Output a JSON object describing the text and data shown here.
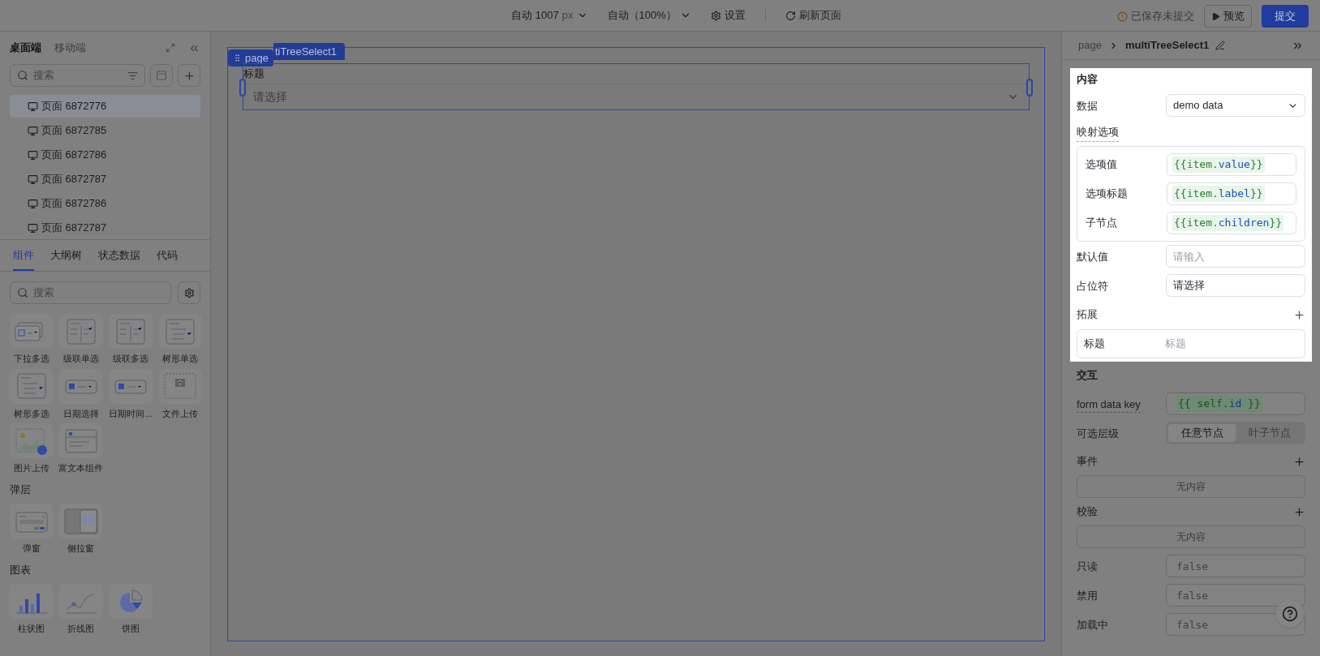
{
  "toolbar": {
    "width_select": "自动 1007",
    "width_unit": "px",
    "zoom_select": "自动（100%）",
    "settings": "设置",
    "refresh": "刷新页面",
    "save_status": "已保存未提交",
    "preview": "预览",
    "submit": "提交"
  },
  "sidebar": {
    "platform_tabs": [
      {
        "label": "桌面端",
        "selected": true
      },
      {
        "label": "移动端",
        "selected": false
      }
    ],
    "page_search_placeholder": "搜索",
    "pages": [
      {
        "label": "页面 6872776",
        "selected": true
      },
      {
        "label": "页面 6872785",
        "selected": false
      },
      {
        "label": "页面 6872786",
        "selected": false
      },
      {
        "label": "页面 6872787",
        "selected": false
      },
      {
        "label": "页面 6872786",
        "selected": false
      },
      {
        "label": "页面 6872787",
        "selected": false
      }
    ],
    "panel_tabs": [
      {
        "label": "组件",
        "selected": true
      },
      {
        "label": "大纲树",
        "selected": false
      },
      {
        "label": "状态数据",
        "selected": false
      },
      {
        "label": "代码",
        "selected": false
      }
    ],
    "component_search_placeholder": "搜索",
    "groups": [
      {
        "items": [
          {
            "label": "下拉多选",
            "kind": "dropdown"
          },
          {
            "label": "级联单选",
            "kind": "cascader"
          },
          {
            "label": "级联多选",
            "kind": "cascader"
          },
          {
            "label": "树形单选",
            "kind": "tree"
          },
          {
            "label": "树形多选",
            "kind": "tree"
          },
          {
            "label": "日期选择",
            "kind": "date"
          },
          {
            "label": "日期时间...",
            "kind": "date"
          },
          {
            "label": "文件上传",
            "kind": "upload"
          },
          {
            "label": "图片上传",
            "kind": "image"
          },
          {
            "label": "富文本组件",
            "kind": "richtext"
          }
        ]
      },
      {
        "title": "弹层",
        "items": [
          {
            "label": "弹窗",
            "kind": "modal"
          },
          {
            "label": "侧拉窗",
            "kind": "drawer"
          }
        ]
      },
      {
        "title": "图表",
        "items": [
          {
            "label": "柱状图",
            "kind": "bar"
          },
          {
            "label": "折线图",
            "kind": "line"
          },
          {
            "label": "饼图",
            "kind": "pie"
          }
        ]
      }
    ]
  },
  "canvas": {
    "page_tag": "page",
    "component_tag": "tiTreeSelect1",
    "field_label": "标题",
    "placeholder": "请选择"
  },
  "inspector": {
    "breadcrumb": [
      "page",
      "multiTreeSelect1"
    ],
    "content": {
      "highlighted": true,
      "title": "内容",
      "data_label": "数据",
      "data_value": "demo data",
      "mapping_title": "映射选项",
      "mappings": [
        {
          "label": "选项值",
          "expr": "{{item.value}}"
        },
        {
          "label": "选项标题",
          "expr": "{{item.label}}"
        },
        {
          "label": "子节点",
          "expr": "{{item.children}}"
        }
      ],
      "default_label": "默认值",
      "default_placeholder": "请输入",
      "prompt_field": {
        "label": "占位符",
        "value": "请选择"
      },
      "extension_title": "拓展",
      "extensions": [
        {
          "label": "标题",
          "placeholder": "标题"
        }
      ]
    },
    "interaction": {
      "title": "交互",
      "form_key_label": "form data key",
      "form_key_expr": "{{ self.id }}",
      "level_label": "可选层级",
      "levels": [
        {
          "label": "任意节点",
          "selected": true
        },
        {
          "label": "叶子节点",
          "selected": false
        }
      ],
      "events_title": "事件",
      "events_empty": "无内容",
      "validation_title": "校验",
      "validation_empty": "无内容",
      "flags": [
        {
          "label": "只读",
          "placeholder": "false"
        },
        {
          "label": "禁用",
          "placeholder": "false"
        },
        {
          "label": "加载中",
          "placeholder": "false"
        }
      ]
    }
  }
}
